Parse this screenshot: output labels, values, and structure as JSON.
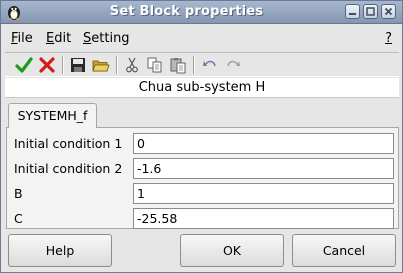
{
  "window": {
    "title": "Set Block properties"
  },
  "menubar": {
    "items": [
      {
        "label": "File",
        "mnemonic": "F",
        "rest": "ile"
      },
      {
        "label": "Edit",
        "mnemonic": "E",
        "rest": "dit"
      },
      {
        "label": "Setting",
        "mnemonic": "S",
        "rest": "etting"
      }
    ],
    "help": "?"
  },
  "toolbar": {
    "icons": [
      "ok-check-icon",
      "cancel-x-icon",
      "save-icon",
      "open-folder-icon",
      "cut-icon",
      "copy-icon",
      "paste-icon",
      "undo-icon",
      "redo-icon"
    ]
  },
  "block": {
    "subtitle": "Chua sub-system H"
  },
  "tab": {
    "label": "SYSTEMH_f"
  },
  "fields": [
    {
      "label": "Initial condition 1",
      "value": "0"
    },
    {
      "label": "Initial condition 2",
      "value": "-1.6"
    },
    {
      "label": "B",
      "value": "1"
    },
    {
      "label": "C",
      "value": "-25.58"
    }
  ],
  "buttons": {
    "help": "Help",
    "ok": "OK",
    "cancel": "Cancel"
  },
  "colors": {
    "titlebar": "#97a7c1",
    "window_bg": "#e6e6e6",
    "check_green": "#1d9a1d",
    "x_red": "#d21d1d"
  }
}
